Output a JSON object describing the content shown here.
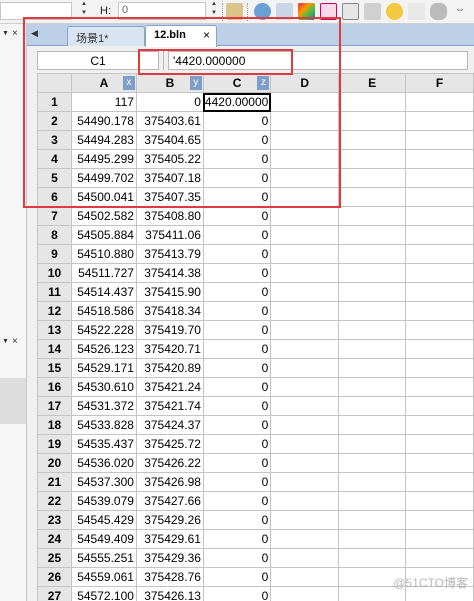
{
  "toolbar": {
    "h_label": "H:",
    "h_value": "0",
    "icons": [
      "lock-icon",
      "globe-icon",
      "map-icon",
      "color-palette-icon",
      "checklist-icon",
      "camera-icon",
      "sun-icon",
      "chart-icon",
      "shape-icon",
      "arrow-icon"
    ]
  },
  "tabs": [
    {
      "label": "场景1*",
      "active": false
    },
    {
      "label": "12.bln",
      "active": true
    }
  ],
  "formula": {
    "cell_ref": "C1",
    "value": "'4420.000000"
  },
  "grid": {
    "columns": [
      {
        "label": "A",
        "tag": "x"
      },
      {
        "label": "B",
        "tag": "y"
      },
      {
        "label": "C",
        "tag": "z"
      },
      {
        "label": "D",
        "tag": ""
      },
      {
        "label": "E",
        "tag": ""
      },
      {
        "label": "F",
        "tag": ""
      }
    ],
    "rows": [
      {
        "num": "1",
        "a": "117",
        "b": "0",
        "c": "4420.00000"
      },
      {
        "num": "2",
        "a": "54490.178",
        "b": "375403.61",
        "c": "0"
      },
      {
        "num": "3",
        "a": "54494.283",
        "b": "375404.65",
        "c": "0"
      },
      {
        "num": "4",
        "a": "54495.299",
        "b": "375405.22",
        "c": "0"
      },
      {
        "num": "5",
        "a": "54499.702",
        "b": "375407.18",
        "c": "0"
      },
      {
        "num": "6",
        "a": "54500.041",
        "b": "375407.35",
        "c": "0"
      },
      {
        "num": "7",
        "a": "54502.582",
        "b": "375408.80",
        "c": "0"
      },
      {
        "num": "8",
        "a": "54505.884",
        "b": "375411.06",
        "c": "0"
      },
      {
        "num": "9",
        "a": "54510.880",
        "b": "375413.79",
        "c": "0"
      },
      {
        "num": "10",
        "a": "54511.727",
        "b": "375414.38",
        "c": "0"
      },
      {
        "num": "11",
        "a": "54514.437",
        "b": "375415.90",
        "c": "0"
      },
      {
        "num": "12",
        "a": "54518.586",
        "b": "375418.34",
        "c": "0"
      },
      {
        "num": "13",
        "a": "54522.228",
        "b": "375419.70",
        "c": "0"
      },
      {
        "num": "14",
        "a": "54526.123",
        "b": "375420.71",
        "c": "0"
      },
      {
        "num": "15",
        "a": "54529.171",
        "b": "375420.89",
        "c": "0"
      },
      {
        "num": "16",
        "a": "54530.610",
        "b": "375421.24",
        "c": "0"
      },
      {
        "num": "17",
        "a": "54531.372",
        "b": "375421.74",
        "c": "0"
      },
      {
        "num": "18",
        "a": "54533.828",
        "b": "375424.37",
        "c": "0"
      },
      {
        "num": "19",
        "a": "54535.437",
        "b": "375425.72",
        "c": "0"
      },
      {
        "num": "20",
        "a": "54536.020",
        "b": "375426.22",
        "c": "0"
      },
      {
        "num": "21",
        "a": "54537.300",
        "b": "375426.98",
        "c": "0"
      },
      {
        "num": "22",
        "a": "54539.079",
        "b": "375427.66",
        "c": "0"
      },
      {
        "num": "23",
        "a": "54545.429",
        "b": "375429.26",
        "c": "0"
      },
      {
        "num": "24",
        "a": "54549.409",
        "b": "375429.61",
        "c": "0"
      },
      {
        "num": "25",
        "a": "54555.251",
        "b": "375429.36",
        "c": "0"
      },
      {
        "num": "26",
        "a": "54559.061",
        "b": "375428.76",
        "c": "0"
      },
      {
        "num": "27",
        "a": "54572.100",
        "b": "375426.13",
        "c": "0"
      }
    ]
  },
  "watermark": "@51CTO博客",
  "colors": {
    "annotation_red": "#e0393e",
    "column_tag": "#7d9ec9",
    "tabbar": "#bcd0e8"
  }
}
